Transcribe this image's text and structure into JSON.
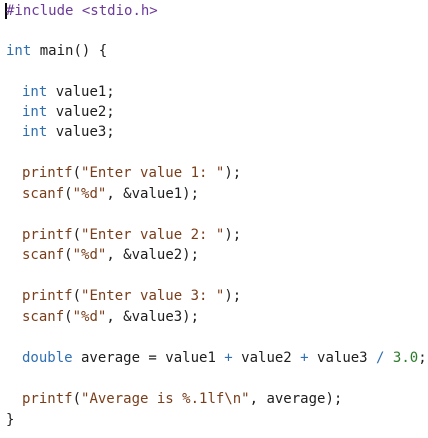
{
  "code": {
    "l1_include": "#include",
    "l1_header": " <stdio.h>",
    "l3_type": "int",
    "l3_rest": " main() {",
    "l5_type": "int",
    "l5_rest": " value1;",
    "l6_type": "int",
    "l6_rest": " value2;",
    "l7_type": "int",
    "l7_rest": " value3;",
    "l9_fn": "printf",
    "l9_open": "(",
    "l9_str": "\"Enter value 1: \"",
    "l9_close": ");",
    "l10_fn": "scanf",
    "l10_open": "(",
    "l10_str": "\"%d\"",
    "l10_rest": ", &value1);",
    "l12_fn": "printf",
    "l12_open": "(",
    "l12_str": "\"Enter value 2: \"",
    "l12_close": ");",
    "l13_fn": "scanf",
    "l13_open": "(",
    "l13_str": "\"%d\"",
    "l13_rest": ", &value2);",
    "l15_fn": "printf",
    "l15_open": "(",
    "l15_str": "\"Enter value 3: \"",
    "l15_close": ");",
    "l16_fn": "scanf",
    "l16_open": "(",
    "l16_str": "\"%d\"",
    "l16_rest": ", &value3);",
    "l18_type": "double",
    "l18_a": " average = value1 ",
    "l18_op1": "+",
    "l18_b": " value2 ",
    "l18_op2": "+",
    "l18_c": " value3 ",
    "l18_op3": "/",
    "l18_sp": " ",
    "l18_num": "3.0",
    "l18_end": ";",
    "l20_fn": "printf",
    "l20_open": "(",
    "l20_str": "\"Average is %.1lf\\n\"",
    "l20_rest": ", average);",
    "l21_close": "}"
  },
  "colors": {
    "keyword": "#2f6fb2",
    "preprocessor": "#6c3a9a",
    "function": "#7a3d1a",
    "string": "#7a3d1a",
    "number": "#2a7a2a",
    "text": "#1d1d1d"
  }
}
